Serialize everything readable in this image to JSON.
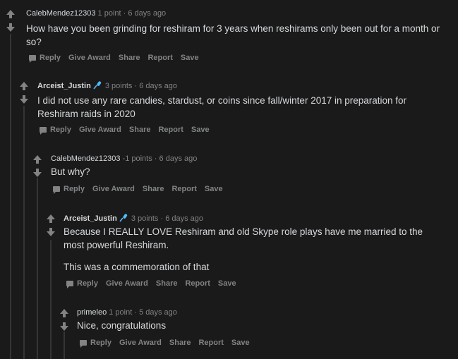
{
  "actions": {
    "reply": "Reply",
    "give_award": "Give Award",
    "share": "Share",
    "report": "Report",
    "save": "Save"
  },
  "comments": [
    {
      "author": "CalebMendez12303",
      "score": "1 point",
      "sep": "·",
      "time": "6 days ago",
      "body": [
        "How have you been grinding for reshiram for 3 years when reshirams only been out for a month or so?"
      ]
    },
    {
      "author": "Arceist_Justin",
      "score": "3 points",
      "sep": "·",
      "time": "6 days ago",
      "body": [
        "I did not use any rare candies, stardust, or coins since fall/winter 2017 in preparation for Reshiram raids in 2020"
      ]
    },
    {
      "author": "CalebMendez12303",
      "score": "-1 points",
      "sep": "·",
      "time": "6 days ago",
      "body": [
        "But why?"
      ]
    },
    {
      "author": "Arceist_Justin",
      "score": "3 points",
      "sep": "·",
      "time": "6 days ago",
      "body": [
        "Because I REALLY LOVE Reshiram and old Skype role plays have me married to the most powerful Reshiram.",
        "This was a commemoration of that"
      ]
    },
    {
      "author": "primeleo",
      "score": "1 point",
      "sep": "·",
      "time": "5 days ago",
      "body": [
        "Nice, congratulations"
      ]
    }
  ],
  "colors": {
    "background": "#1a1a1b",
    "text": "#d7dadc",
    "muted": "#818384",
    "thread": "#343536",
    "flair": "#4fbcff"
  }
}
